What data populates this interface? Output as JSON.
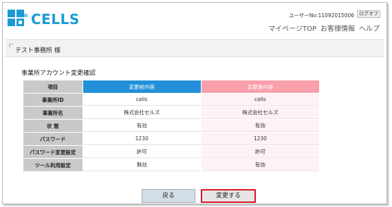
{
  "header": {
    "brand": "CELLS",
    "user_no": "ユーザーNo:11092015006",
    "logout_label": "ログオフ",
    "nav": [
      "マイページTOP",
      "お客様情報",
      "ヘルプ"
    ]
  },
  "office_bar": {
    "name": "テスト事務所 様"
  },
  "section_title": "事業所アカウント変更確認",
  "table": {
    "headers": {
      "item": "項目",
      "before": "変更前内容",
      "after": "変更後内容"
    },
    "rows": [
      {
        "label": "事業所ID",
        "before": "cells",
        "after": "cells"
      },
      {
        "label": "事業所名",
        "before": "株式会社セルズ",
        "after": "株式会社セルズ"
      },
      {
        "label": "状 態",
        "before": "有効",
        "after": "有効"
      },
      {
        "label": "パスワード",
        "before": "1230",
        "after": "1230"
      },
      {
        "label": "パスワード変更設定",
        "before": "許可",
        "after": "許可"
      },
      {
        "label": "ツール利用設定",
        "before": "無効",
        "after": "有効"
      }
    ]
  },
  "buttons": {
    "back": "戻る",
    "change": "変更する"
  },
  "colors": {
    "brand": "#1a9ad6",
    "before_header": "#2190d8",
    "after_header": "#f9a0ab",
    "highlight_border": "#d8141d"
  }
}
